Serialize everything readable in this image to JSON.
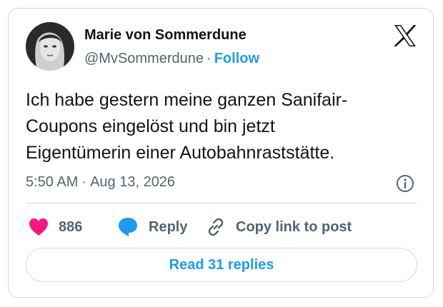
{
  "author": {
    "name": "Marie von Sommerdune",
    "handle": "@MvSommerdune",
    "separator": "·",
    "follow_label": "Follow"
  },
  "tweet": {
    "text": "Ich habe gestern meine ganzen Sanifair-\nCoupons eingelöst und bin jetzt\nEigentümerin einer Autobahnraststätte.",
    "time": "5:50 AM",
    "separator": "·",
    "date": "Aug 13, 2026"
  },
  "actions": {
    "like_count": "886",
    "reply_label": "Reply",
    "copy_label": "Copy link to post"
  },
  "read_replies_label": "Read 31 replies",
  "icons": {
    "logo": "x-logo-icon",
    "info": "info-icon",
    "like": "heart-icon",
    "reply": "speech-bubble-icon",
    "copy": "link-icon"
  },
  "colors": {
    "accent": "#1d9bf0",
    "like": "#f91880",
    "text": "#0f1419",
    "muted": "#536471",
    "border": "#cfd9de"
  }
}
